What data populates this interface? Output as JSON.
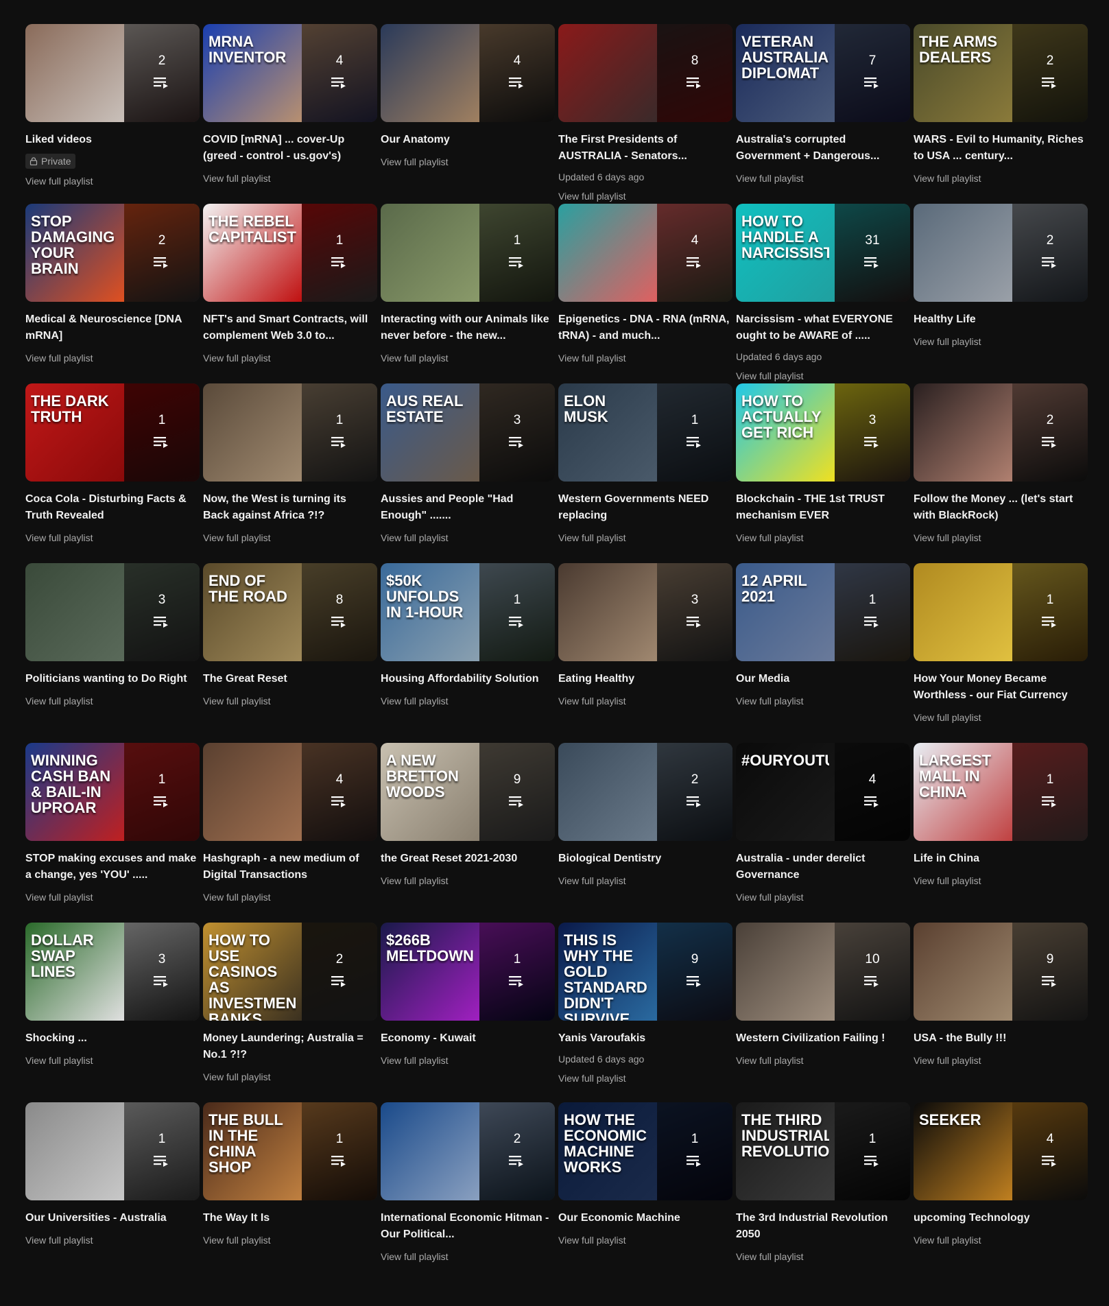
{
  "playlists": [
    {
      "title": "Liked videos",
      "count": "2",
      "private": "Private",
      "updated": "",
      "thumb_text": "",
      "c1": "#8a6b5a",
      "c2": "#c9c0ba",
      "c3": "#3a2a2a"
    },
    {
      "title": "COVID [mRNA] ... cover-Up (greed - control - us.gov's)",
      "count": "4",
      "private": "",
      "updated": "",
      "thumb_text": "mRNA INVENTOR",
      "c1": "#1a3fb0",
      "c2": "#b89070",
      "c3": "#2a2a4a"
    },
    {
      "title": "Our Anatomy",
      "count": "4",
      "private": "",
      "updated": "",
      "thumb_text": "",
      "c1": "#2a3a5a",
      "c2": "#a08060",
      "c3": "#1a1a1a"
    },
    {
      "title": "The First Presidents of AUSTRALIA - Senators...",
      "count": "8",
      "private": "",
      "updated": "Updated 6 days ago",
      "thumb_text": "",
      "c1": "#8a1a1a",
      "c2": "#3a2a2a",
      "c3": "#6a1010"
    },
    {
      "title": "Australia's corrupted Government + Dangerous...",
      "count": "7",
      "private": "",
      "updated": "",
      "thumb_text": "Veteran Australian diplomat",
      "c1": "#1a2a5a",
      "c2": "#4a5a7a",
      "c3": "#1a1a3a"
    },
    {
      "title": "WARS - Evil to Humanity, Riches to USA ... century...",
      "count": "2",
      "private": "",
      "updated": "",
      "thumb_text": "THE ARMS DEALERS",
      "c1": "#4a4a2a",
      "c2": "#8a7a3a",
      "c3": "#2a2a1a"
    },
    {
      "title": "Medical & Neuroscience [DNA mRNA]",
      "count": "2",
      "private": "",
      "updated": "",
      "thumb_text": "STOP DAMAGING YOUR BRAIN",
      "c1": "#1a3a7a",
      "c2": "#e05020",
      "c3": "#2a2a2a"
    },
    {
      "title": "NFT's and Smart Contracts, will complement Web 3.0 to...",
      "count": "1",
      "private": "",
      "updated": "",
      "thumb_text": "THE REBEL CAPITALIST",
      "c1": "#f2f2f2",
      "c2": "#c01010",
      "c3": "#3a3a3a"
    },
    {
      "title": "Interacting with our Animals like never before - the new...",
      "count": "1",
      "private": "",
      "updated": "",
      "thumb_text": "",
      "c1": "#5a6a4a",
      "c2": "#8a9a6a",
      "c3": "#2a3020"
    },
    {
      "title": "Epigenetics - DNA - RNA (mRNA, tRNA) - and much...",
      "count": "4",
      "private": "",
      "updated": "",
      "thumb_text": "",
      "c1": "#2aa0a0",
      "c2": "#e06060",
      "c3": "#3a3a2a"
    },
    {
      "title": "Narcissism - what EVERYONE ought to be AWARE of .....",
      "count": "31",
      "private": "",
      "updated": "Updated 6 days ago",
      "thumb_text": "How to handle a narcissist",
      "c1": "#10c0c0",
      "c2": "#20a0a0",
      "c3": "#2a2020"
    },
    {
      "title": "Healthy Life",
      "count": "2",
      "private": "",
      "updated": "",
      "thumb_text": "",
      "c1": "#5a6a7a",
      "c2": "#9aa0a8",
      "c3": "#2a3038"
    },
    {
      "title": "Coca Cola - Disturbing Facts & Truth Revealed",
      "count": "1",
      "private": "",
      "updated": "",
      "thumb_text": "The DARK TRUTH",
      "c1": "#c01818",
      "c2": "#8a0a0a",
      "c3": "#3a1010"
    },
    {
      "title": "Now, the West is turning its Back against Africa ?!?",
      "count": "1",
      "private": "",
      "updated": "",
      "thumb_text": "",
      "c1": "#5a4a3a",
      "c2": "#a08a70",
      "c3": "#2a2a2a"
    },
    {
      "title": "Aussies and People \"Had Enough\" .......",
      "count": "3",
      "private": "",
      "updated": "",
      "thumb_text": "AUS REAL ESTATE",
      "c1": "#3a5a8a",
      "c2": "#6a5a4a",
      "c3": "#1a1a1a"
    },
    {
      "title": "Western Governments NEED replacing",
      "count": "1",
      "private": "",
      "updated": "",
      "thumb_text": "ELON MUSK",
      "c1": "#2a3a4a",
      "c2": "#4a5a6a",
      "c3": "#1a2028"
    },
    {
      "title": "Blockchain - THE 1st TRUST mechanism EVER",
      "count": "3",
      "private": "",
      "updated": "",
      "thumb_text": "HOW TO ACTUALLY GET RICH",
      "c1": "#20c8e8",
      "c2": "#f0e020",
      "c3": "#3a2a20"
    },
    {
      "title": "Follow the Money ... (let's start with BlackRock)",
      "count": "2",
      "private": "",
      "updated": "",
      "thumb_text": "",
      "c1": "#2a2020",
      "c2": "#b08070",
      "c3": "#1a1a1a"
    },
    {
      "title": "Politicians wanting to Do Right",
      "count": "3",
      "private": "",
      "updated": "",
      "thumb_text": "",
      "c1": "#3a4a3a",
      "c2": "#5a6a5a",
      "c3": "#2a2a2a"
    },
    {
      "title": "The Great Reset",
      "count": "8",
      "private": "",
      "updated": "",
      "thumb_text": "END OF THE ROAD",
      "c1": "#5a4a2a",
      "c2": "#a08a5a",
      "c3": "#3a3020"
    },
    {
      "title": "Housing Affordability Solution",
      "count": "1",
      "private": "",
      "updated": "",
      "thumb_text": "$50K unfolds in 1-hour",
      "c1": "#3a6a9a",
      "c2": "#8aa0b0",
      "c3": "#2a3a2a"
    },
    {
      "title": "Eating Healthy",
      "count": "3",
      "private": "",
      "updated": "",
      "thumb_text": "",
      "c1": "#4a3a30",
      "c2": "#a08870",
      "c3": "#2a2a2a"
    },
    {
      "title": "Our Media",
      "count": "1",
      "private": "",
      "updated": "",
      "thumb_text": "12 APRIL 2021",
      "c1": "#3a5a8a",
      "c2": "#6a7a9a",
      "c3": "#3a3020"
    },
    {
      "title": "How Your Money Became Worthless - our Fiat Currency",
      "count": "1",
      "private": "",
      "updated": "",
      "thumb_text": "",
      "c1": "#b08a20",
      "c2": "#e0c040",
      "c3": "#5a4010"
    },
    {
      "title": "STOP making excuses and make a change, yes 'YOU' .....",
      "count": "1",
      "private": "",
      "updated": "",
      "thumb_text": "WINNING CASH BAN & BAIL-IN UPROAR",
      "c1": "#1a3a8a",
      "c2": "#c02020",
      "c3": "#6a1010"
    },
    {
      "title": "Hashgraph - a new medium of Digital Transactions",
      "count": "4",
      "private": "",
      "updated": "",
      "thumb_text": "",
      "c1": "#5a4030",
      "c2": "#a07050",
      "c3": "#2a2020"
    },
    {
      "title": "the Great Reset 2021-2030",
      "count": "9",
      "private": "",
      "updated": "",
      "thumb_text": "A NEW BRETTON WOODS",
      "c1": "#c8c0b0",
      "c2": "#8a8070",
      "c3": "#3a3a3a"
    },
    {
      "title": "Biological Dentistry",
      "count": "2",
      "private": "",
      "updated": "",
      "thumb_text": "",
      "c1": "#3a4a5a",
      "c2": "#6a7a8a",
      "c3": "#1a2028"
    },
    {
      "title": "Australia - under derelict Governance",
      "count": "4",
      "private": "",
      "updated": "",
      "thumb_text": "#OURYOUTUBE",
      "c1": "#0a0a0a",
      "c2": "#1a1a1a",
      "c3": "#0a0a0a"
    },
    {
      "title": "Life in China",
      "count": "1",
      "private": "",
      "updated": "",
      "thumb_text": "LARGEST MALL IN CHINA",
      "c1": "#e8eef4",
      "c2": "#c04040",
      "c3": "#4a3a3a"
    },
    {
      "title": "Shocking ...",
      "count": "3",
      "private": "",
      "updated": "",
      "thumb_text": "DOLLAR SWAP LINES",
      "c1": "#2a6a2a",
      "c2": "#e0e0e0",
      "c3": "#2a2a2a"
    },
    {
      "title": "Money Laundering; Australia = No.1 ?!?",
      "count": "2",
      "private": "",
      "updated": "",
      "thumb_text": "HOW TO USE CASINOS AS INVESTMENT BANKS",
      "c1": "#c09030",
      "c2": "#3a3020",
      "c3": "#2a2a2a"
    },
    {
      "title": "Economy - Kuwait",
      "count": "1",
      "private": "",
      "updated": "",
      "thumb_text": "$266B MELTDOWN",
      "c1": "#1a1a4a",
      "c2": "#a020c0",
      "c3": "#0a0a2a"
    },
    {
      "title": "Yanis Varoufakis",
      "count": "9",
      "private": "",
      "updated": "Updated 6 days ago",
      "thumb_text": "THIS IS WHY THE GOLD STANDARD DIDN'T SURVIVE",
      "c1": "#0a1a4a",
      "c2": "#2a6aa0",
      "c3": "#1a1a2a"
    },
    {
      "title": "Western Civilization Failing !",
      "count": "10",
      "private": "",
      "updated": "",
      "thumb_text": "",
      "c1": "#4a4038",
      "c2": "#a09080",
      "c3": "#2a2a2a"
    },
    {
      "title": "USA - the Bully !!!",
      "count": "9",
      "private": "",
      "updated": "",
      "thumb_text": "",
      "c1": "#5a4030",
      "c2": "#a08a70",
      "c3": "#2a2a2a"
    },
    {
      "title": "Our Universities - Australia",
      "count": "1",
      "private": "",
      "updated": "",
      "thumb_text": "",
      "c1": "#8a8a8a",
      "c2": "#c8c8c8",
      "c3": "#3a3a3a"
    },
    {
      "title": "The Way It Is",
      "count": "1",
      "private": "",
      "updated": "",
      "thumb_text": "The Bull In The China Shop",
      "c1": "#4a2a1a",
      "c2": "#c08040",
      "c3": "#2a1a10"
    },
    {
      "title": "International Economic Hitman - Our Political...",
      "count": "2",
      "private": "",
      "updated": "",
      "thumb_text": "",
      "c1": "#1a4a8a",
      "c2": "#8aa0c0",
      "c3": "#1a2a3a"
    },
    {
      "title": "Our Economic Machine",
      "count": "1",
      "private": "",
      "updated": "",
      "thumb_text": "HOW THE ECONOMIC MACHINE WORKS",
      "c1": "#0a1a3a",
      "c2": "#1a2a4a",
      "c3": "#0a0a1a"
    },
    {
      "title": "The 3rd Industrial Revolution 2050",
      "count": "1",
      "private": "",
      "updated": "",
      "thumb_text": "THE THIRD INDUSTRIAL REVOLUTION",
      "c1": "#1a1a1a",
      "c2": "#3a3a3a",
      "c3": "#0a0a0a"
    },
    {
      "title": "upcoming Technology",
      "count": "4",
      "private": "",
      "updated": "",
      "thumb_text": "Seeker",
      "c1": "#0a0a0a",
      "c2": "#c08020",
      "c3": "#1a1a1a"
    }
  ],
  "labels": {
    "view_full_playlist": "View full playlist"
  }
}
